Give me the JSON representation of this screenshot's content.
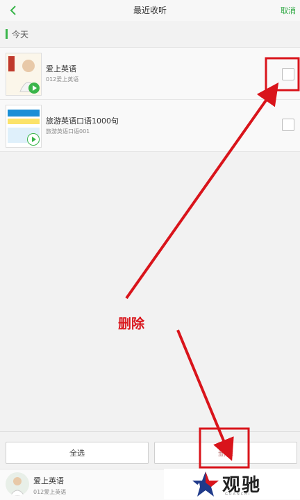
{
  "header": {
    "title": "最近收听",
    "cancel_label": "取消"
  },
  "section": {
    "label": "今天"
  },
  "items": [
    {
      "title": "爱上英语",
      "subtitle": "012爱上英语"
    },
    {
      "title": "旅游英语口语1000句",
      "subtitle": "旅游英语口语001"
    }
  ],
  "bottom": {
    "select_all_label": "全选",
    "delete_label": "删除"
  },
  "player": {
    "title": "爱上英语",
    "subtitle": "012爱上英语"
  },
  "annotation": {
    "label": "删除"
  },
  "watermark": {
    "text": "观驰",
    "sub": "GUANCHI"
  },
  "colors": {
    "accent": "#39b54a",
    "annotation": "#d9141b"
  }
}
